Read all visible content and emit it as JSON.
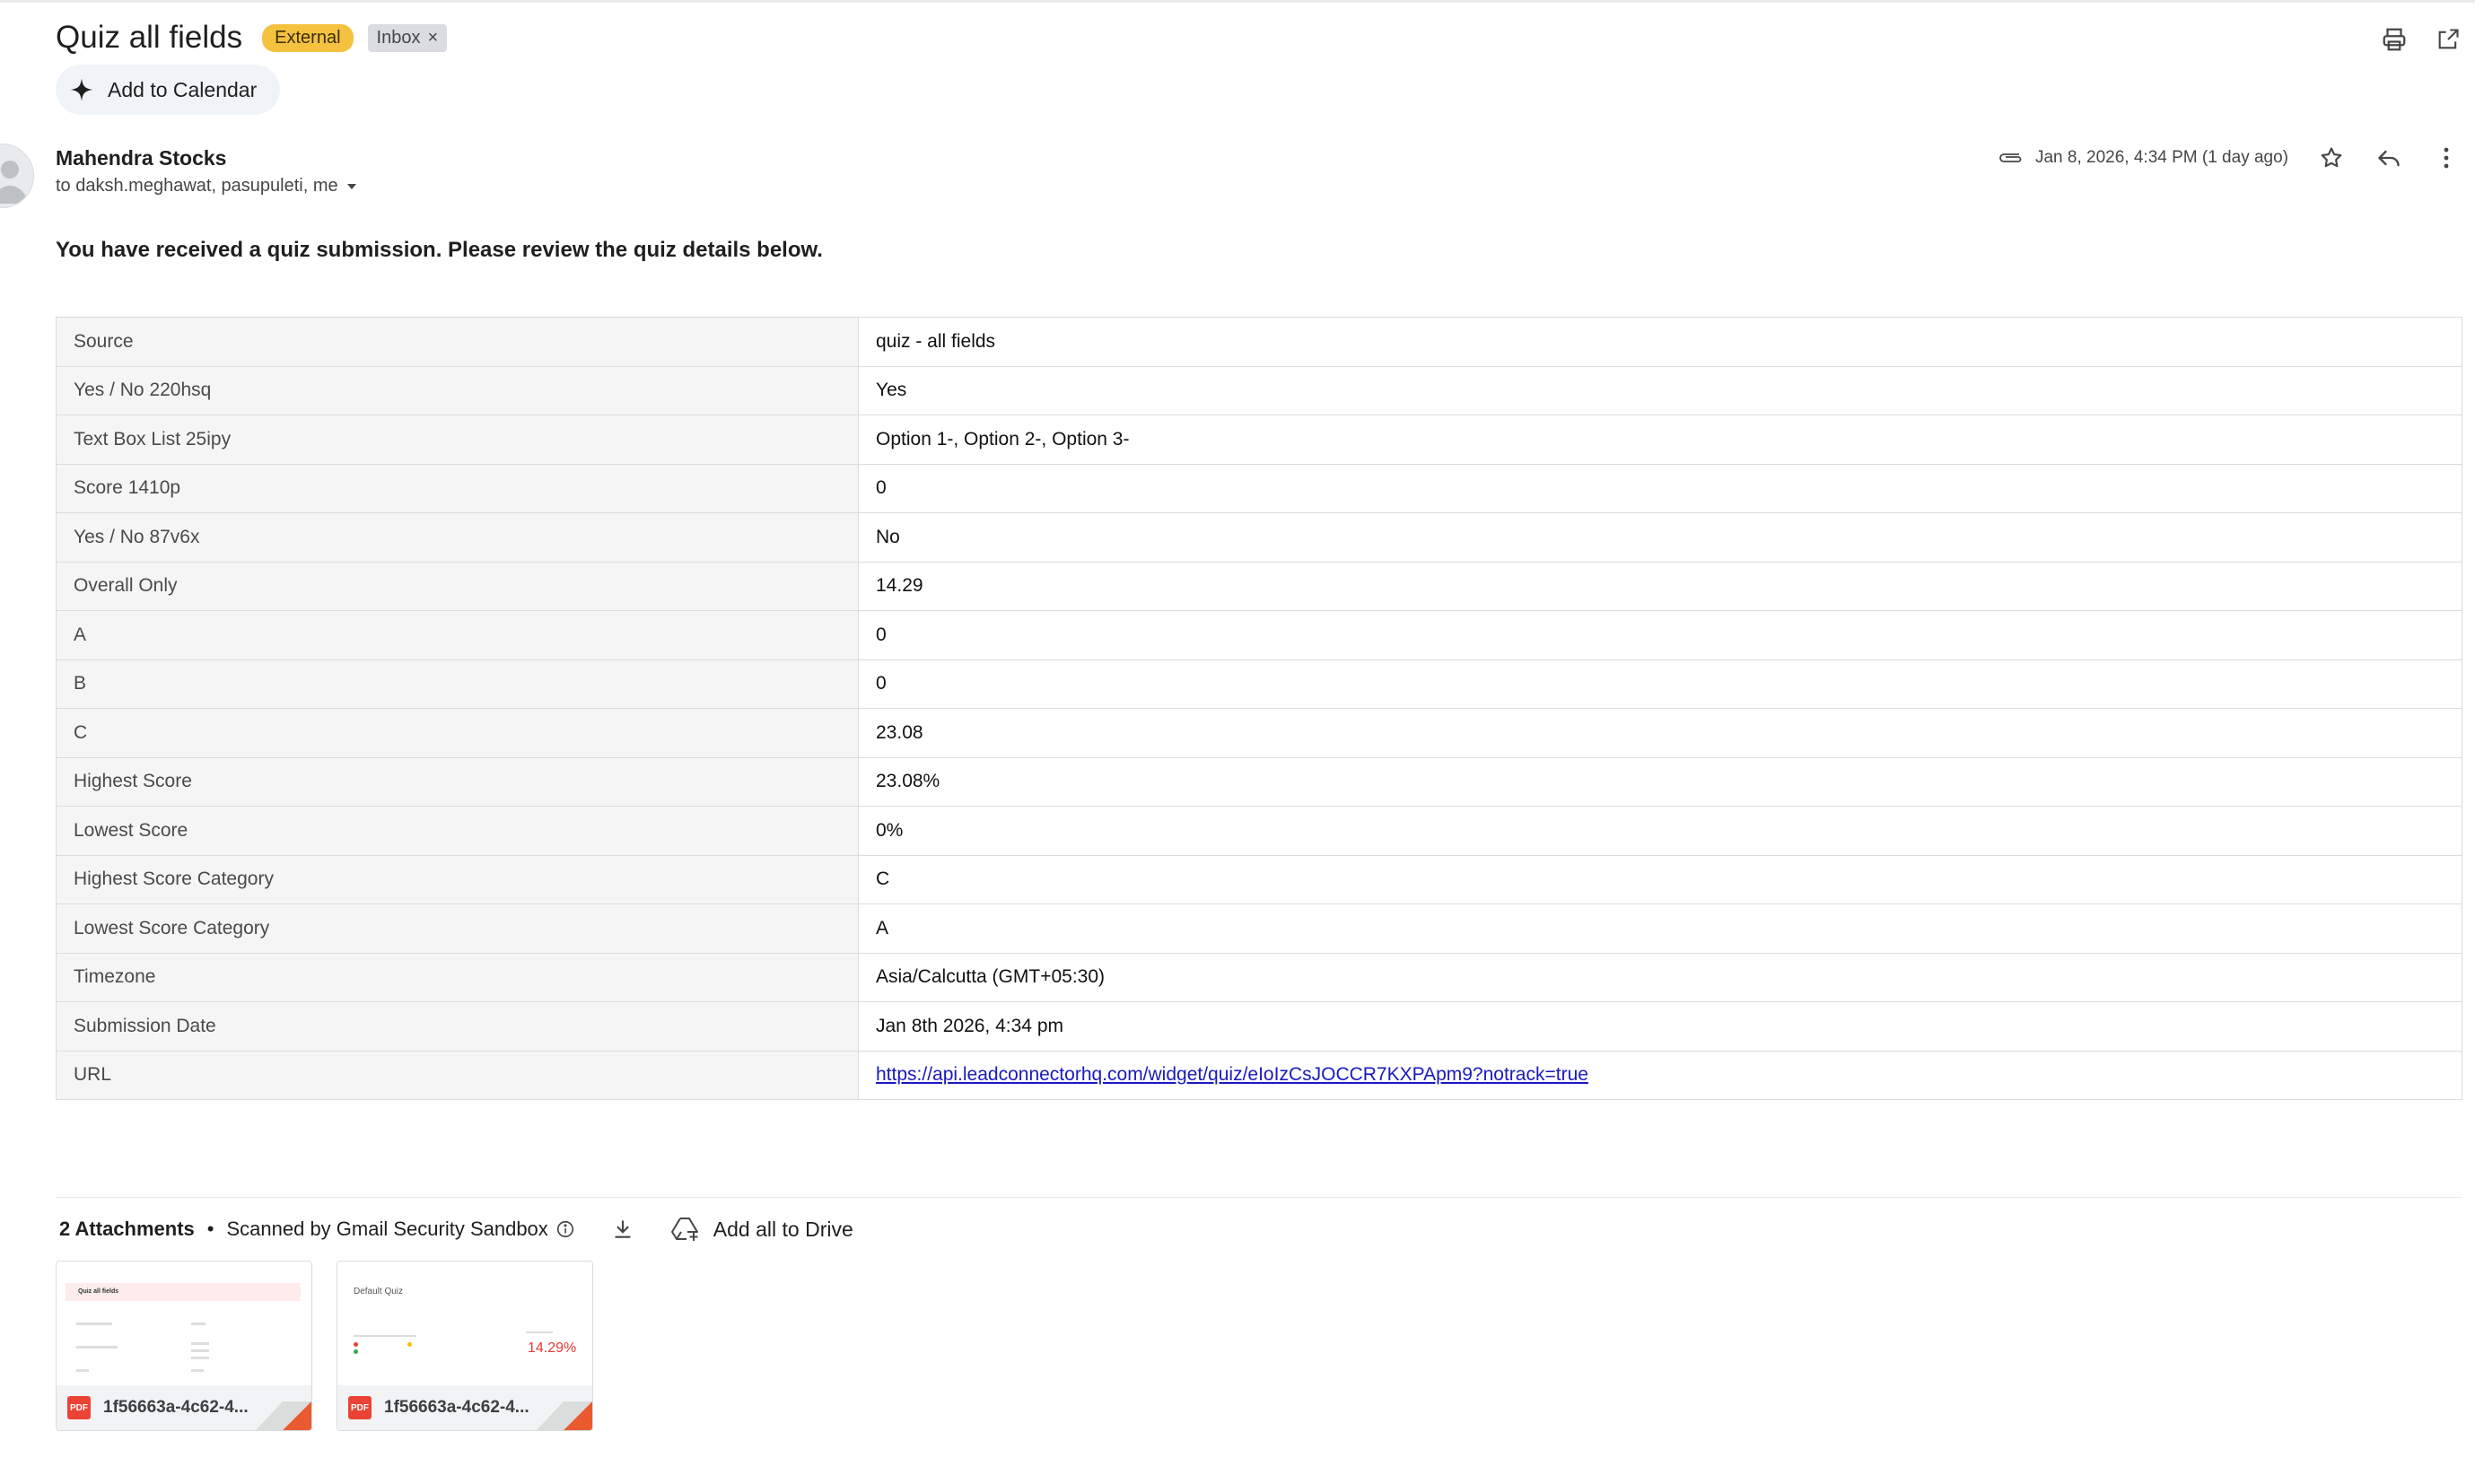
{
  "email": {
    "subject": "Quiz all fields",
    "labels": {
      "external": "External",
      "inbox": "Inbox",
      "remove_glyph": "×"
    },
    "add_to_calendar": "Add to Calendar",
    "sender": "Mahendra Stocks",
    "recipients": "to daksh.meghawat, pasupuleti, me",
    "date": "Jan 8, 2026, 4:34 PM (1 day ago)",
    "intro": "You have received a quiz submission. Please review the quiz details below.",
    "fields": [
      {
        "label": "Source",
        "value": "quiz - all fields"
      },
      {
        "label": "Yes / No 220hsq",
        "value": "Yes"
      },
      {
        "label": "Text Box List 25ipy",
        "value": "Option 1-, Option 2-, Option 3-"
      },
      {
        "label": "Score 1410p",
        "value": "0"
      },
      {
        "label": "Yes / No 87v6x",
        "value": "No"
      },
      {
        "label": "Overall Only",
        "value": "14.29"
      },
      {
        "label": "A",
        "value": "0"
      },
      {
        "label": "B",
        "value": "0"
      },
      {
        "label": "C",
        "value": "23.08"
      },
      {
        "label": "Highest Score",
        "value": "23.08%"
      },
      {
        "label": "Lowest Score",
        "value": "0%"
      },
      {
        "label": "Highest Score Category",
        "value": "C"
      },
      {
        "label": "Lowest Score Category",
        "value": "A"
      },
      {
        "label": "Timezone",
        "value": "Asia/Calcutta (GMT+05:30)"
      },
      {
        "label": "Submission Date",
        "value": "Jan 8th 2026, 4:34 pm"
      },
      {
        "label": "URL",
        "value": "https://api.leadconnectorhq.com/widget/quiz/eIoIzCsJOCCR7KXPApm9?notrack=true"
      }
    ]
  },
  "attachments": {
    "count_label": "2 Attachments",
    "separator": "•",
    "scanned_label": "Scanned by Gmail Security Sandbox",
    "add_to_drive": "Add all to Drive",
    "files": [
      {
        "name": "1f56663a-4c62-4...",
        "type_badge": "PDF",
        "thumb_title": "Quiz all fields"
      },
      {
        "name": "1f56663a-4c62-4...",
        "type_badge": "PDF",
        "thumb_title": "Default Quiz",
        "thumb_score": "14.29%"
      }
    ]
  },
  "colors": {
    "external_badge": "#f4c23f",
    "pdf_red": "#ea4335",
    "link": "#1a1ac0"
  },
  "icons": [
    "print-icon",
    "open-in-new-icon",
    "sparkle-icon",
    "chevron-down-icon",
    "attachment-clip-icon",
    "star-icon",
    "reply-icon",
    "more-vert-icon",
    "info-icon",
    "download-icon",
    "add-to-drive-icon"
  ]
}
